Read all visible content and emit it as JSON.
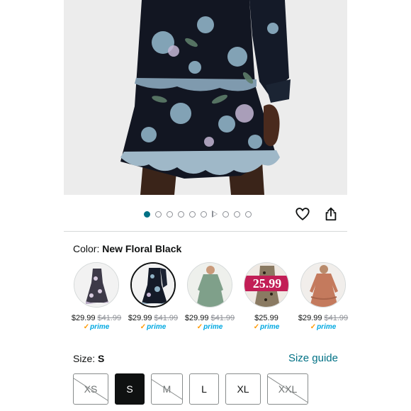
{
  "colors": {
    "accent": "#007185",
    "link": "#007185",
    "prime": "#00a8e1",
    "strike": "#8d9096",
    "selected_size_bg": "#0f1111"
  },
  "gallery": {
    "image_icon": "floral-dress-photo",
    "dot_count": 10,
    "active_index": 0,
    "video_index": 6,
    "favorite_icon": "heart-icon",
    "share_icon": "share-icon"
  },
  "color_selector": {
    "label": "Color:",
    "selected": "New Floral Black",
    "options": [
      {
        "icon": "floral-print-dress-thumb",
        "price": "$29.99",
        "was": "$41.99",
        "prime": "prime",
        "selected": false
      },
      {
        "icon": "dark-floral-dress-thumb",
        "price": "$29.99",
        "was": "$41.99",
        "prime": "prime",
        "selected": true
      },
      {
        "icon": "green-dress-thumb",
        "price": "$29.99",
        "was": "$41.99",
        "prime": "prime",
        "selected": false
      },
      {
        "icon": "leopard-dress-thumb",
        "badge": "25.99",
        "price": "$25.99",
        "was": "",
        "prime": "prime",
        "selected": false
      },
      {
        "icon": "rust-dress-thumb",
        "price": "$29.99",
        "was": "$41.99",
        "prime": "prime",
        "selected": false
      }
    ]
  },
  "size_selector": {
    "label": "Size:",
    "selected": "S",
    "guide_link": "Size guide",
    "options": [
      {
        "label": "XS",
        "available": false,
        "selected": false
      },
      {
        "label": "S",
        "available": true,
        "selected": true
      },
      {
        "label": "M",
        "available": false,
        "selected": false
      },
      {
        "label": "L",
        "available": true,
        "selected": false
      },
      {
        "label": "XL",
        "available": true,
        "selected": false
      },
      {
        "label": "XXL",
        "available": false,
        "selected": false
      }
    ]
  }
}
